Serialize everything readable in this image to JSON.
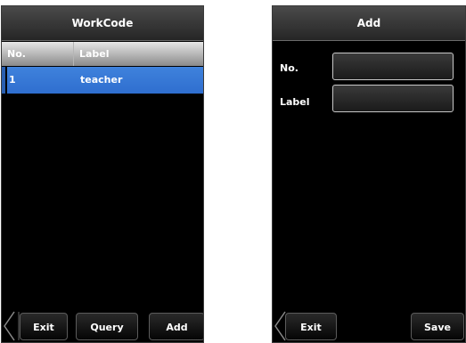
{
  "left_screen": {
    "title": "WorkCode",
    "columns": [
      "No.",
      "Label"
    ],
    "rows": [
      {
        "no": "1",
        "label": "teacher"
      }
    ],
    "buttons": {
      "exit": "Exit",
      "query": "Query",
      "add": "Add"
    }
  },
  "right_screen": {
    "title": "Add",
    "fields": {
      "no_label": "No.",
      "no_value": "",
      "label_label": "Label",
      "label_value": ""
    },
    "buttons": {
      "exit": "Exit",
      "save": "Save"
    }
  },
  "colors": {
    "selected_row": "#3a7ad8",
    "background": "#000000"
  }
}
